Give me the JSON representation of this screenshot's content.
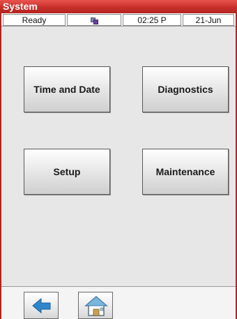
{
  "window": {
    "title": "System"
  },
  "status": {
    "state": "Ready",
    "time": "02:25 P",
    "date": "21-Jun",
    "icon": "network-status-icon"
  },
  "buttons": {
    "time_date": "Time and Date",
    "diagnostics": "Diagnostics",
    "setup": "Setup",
    "maintenance": "Maintenance"
  },
  "nav": {
    "back_icon": "back-arrow-icon",
    "home_icon": "home-icon"
  },
  "colors": {
    "title_bar": "#c8302b",
    "content_bg": "#e7e7e7",
    "back_arrow": "#2f86cc"
  }
}
